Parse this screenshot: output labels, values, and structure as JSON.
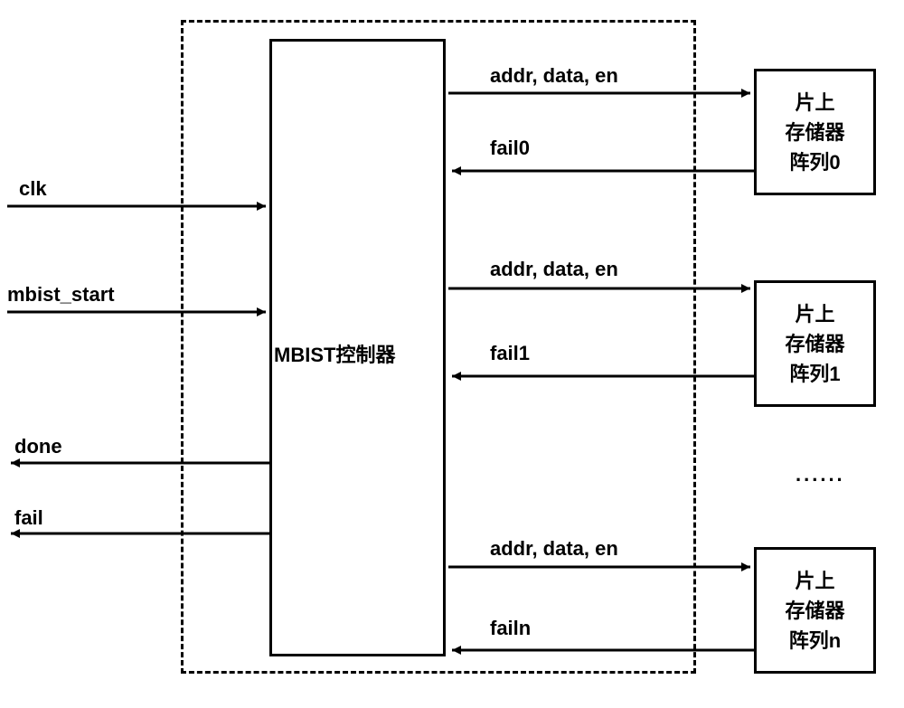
{
  "controller": {
    "label": "MBIST控制器"
  },
  "inputs": {
    "clk": "clk",
    "mbist_start": "mbist_start"
  },
  "outputs": {
    "done": "done",
    "fail": "fail"
  },
  "memories": [
    {
      "line1": "片上",
      "line2": "存储器",
      "line3": "阵列0",
      "out_signals": "addr, data, en",
      "fail_signal": "fail0"
    },
    {
      "line1": "片上",
      "line2": "存储器",
      "line3": "阵列1",
      "out_signals": "addr, data, en",
      "fail_signal": "fail1"
    },
    {
      "line1": "片上",
      "line2": "存储器",
      "line3": "阵列n",
      "out_signals": "addr, data, en",
      "fail_signal": "failn"
    }
  ],
  "ellipsis": "......"
}
